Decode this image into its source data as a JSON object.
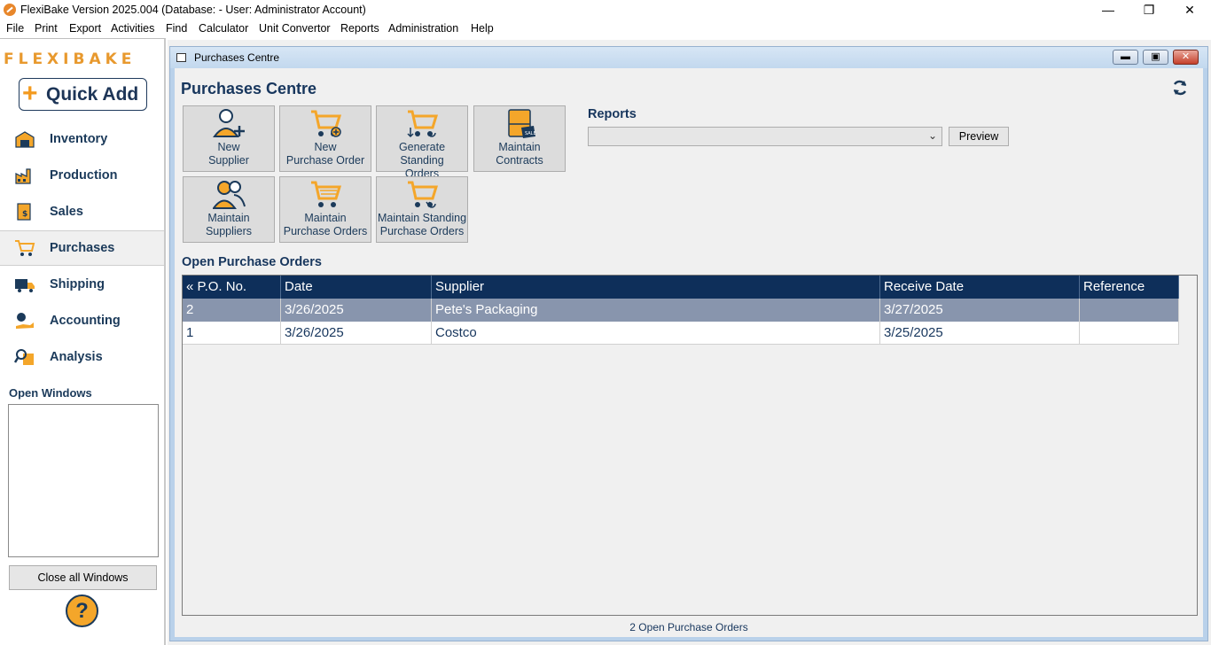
{
  "window": {
    "title": "FlexiBake Version 2025.004 (Database:  - User: Administrator Account)"
  },
  "menu": [
    "File",
    "Print",
    "Export",
    "Activities",
    "Find",
    "Calculator",
    "Unit Convertor",
    "Reports",
    "Administration",
    "Help"
  ],
  "sidebar": {
    "logo_text": "FLEXIBAKE",
    "quick_add": "Quick Add",
    "items": [
      {
        "label": "Inventory",
        "icon": "warehouse-icon"
      },
      {
        "label": "Production",
        "icon": "factory-icon"
      },
      {
        "label": "Sales",
        "icon": "receipt-icon"
      },
      {
        "label": "Purchases",
        "icon": "cart-icon",
        "active": true
      },
      {
        "label": "Shipping",
        "icon": "truck-icon"
      },
      {
        "label": "Accounting",
        "icon": "money-hand-icon"
      },
      {
        "label": "Analysis",
        "icon": "magnifier-chart-icon"
      }
    ],
    "open_windows_label": "Open Windows",
    "close_all": "Close all Windows",
    "help": "?"
  },
  "child_window": {
    "title": "Purchases Centre",
    "page_title": "Purchases Centre",
    "tiles": [
      {
        "line1": "New",
        "line2": "Supplier",
        "icon": "add-user-icon"
      },
      {
        "line1": "New",
        "line2": "Purchase Order",
        "icon": "cart-add-icon"
      },
      {
        "line1": "Generate Standing",
        "line2": "Orders",
        "icon": "cart-generate-icon"
      },
      {
        "line1": "Maintain",
        "line2": "Contracts",
        "icon": "contract-icon"
      },
      {
        "line1": "Maintain",
        "line2": "Suppliers",
        "icon": "users-icon"
      },
      {
        "line1": "Maintain",
        "line2": "Purchase Orders",
        "icon": "cart-icon"
      },
      {
        "line1": "Maintain Standing",
        "line2": "Purchase Orders",
        "icon": "cart-repeat-icon"
      }
    ],
    "reports_label": "Reports",
    "reports_selected": "",
    "preview": "Preview",
    "open_po_label": "Open Purchase Orders",
    "columns": [
      "« P.O. No.",
      "Date",
      "Supplier",
      "Receive Date",
      "Reference"
    ],
    "rows": [
      [
        "2",
        "3/26/2025",
        "Pete's Packaging",
        "3/27/2025",
        ""
      ],
      [
        "1",
        "3/26/2025",
        "Costco",
        "3/25/2025",
        ""
      ]
    ],
    "status": "2 Open Purchase Orders"
  },
  "colors": {
    "accent": "#f39a1e",
    "navy": "#0e2f5a",
    "selected_row": "#8895ad"
  }
}
